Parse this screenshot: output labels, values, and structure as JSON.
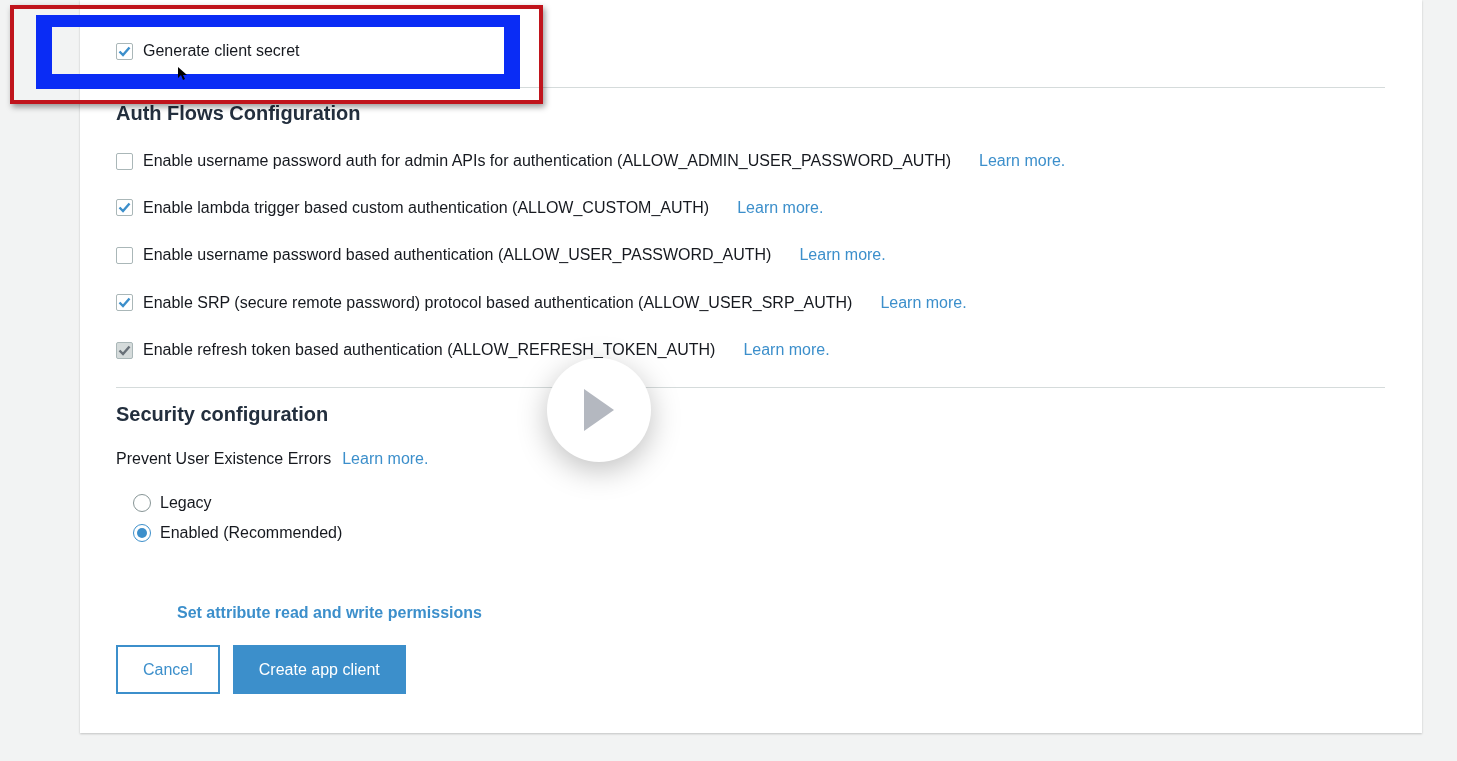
{
  "client_secret": {
    "label": "Generate client secret",
    "checked": true
  },
  "auth_flows": {
    "title": "Auth Flows Configuration",
    "items": [
      {
        "label": "Enable username password auth for admin APIs for authentication (ALLOW_ADMIN_USER_PASSWORD_AUTH)",
        "checked": false,
        "disabled": false,
        "link": "Learn more."
      },
      {
        "label": "Enable lambda trigger based custom authentication (ALLOW_CUSTOM_AUTH)",
        "checked": true,
        "disabled": false,
        "link": "Learn more."
      },
      {
        "label": "Enable username password based authentication (ALLOW_USER_PASSWORD_AUTH)",
        "checked": false,
        "disabled": false,
        "link": "Learn more."
      },
      {
        "label": "Enable SRP (secure remote password) protocol based authentication (ALLOW_USER_SRP_AUTH)",
        "checked": true,
        "disabled": false,
        "link": "Learn more."
      },
      {
        "label": "Enable refresh token based authentication (ALLOW_REFRESH_TOKEN_AUTH)",
        "checked": true,
        "disabled": true,
        "link": "Learn more."
      }
    ]
  },
  "security": {
    "title": "Security configuration",
    "label": "Prevent User Existence Errors",
    "link": "Learn more.",
    "options": [
      {
        "label": "Legacy",
        "selected": false
      },
      {
        "label": "Enabled (Recommended)",
        "selected": true
      }
    ]
  },
  "permissions_link": "Set attribute read and write permissions",
  "buttons": [
    {
      "label": "Cancel",
      "kind": "secondary"
    },
    {
      "label": "Create app client",
      "kind": "primary"
    }
  ]
}
